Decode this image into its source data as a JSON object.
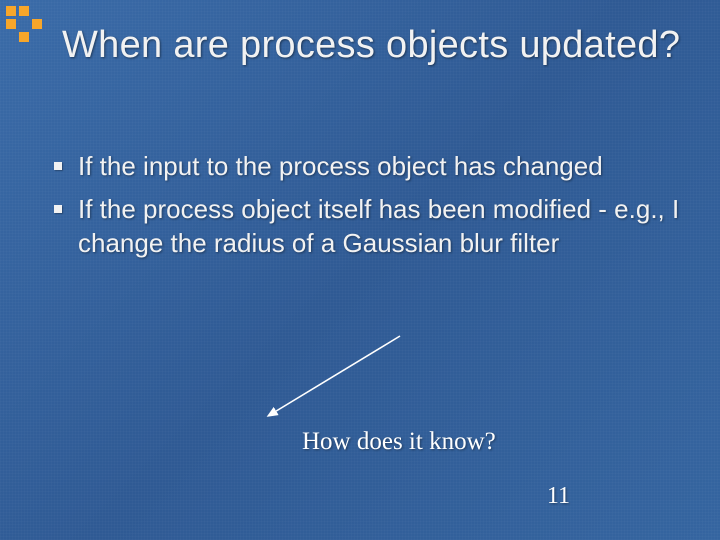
{
  "title": "When are process objects updated?",
  "bullets": [
    "If the input to the process object has changed",
    "If the process object itself has been modified - e.g., I change the radius of a Gaussian blur filter"
  ],
  "annotation": "How does it know?",
  "page_number": "11"
}
